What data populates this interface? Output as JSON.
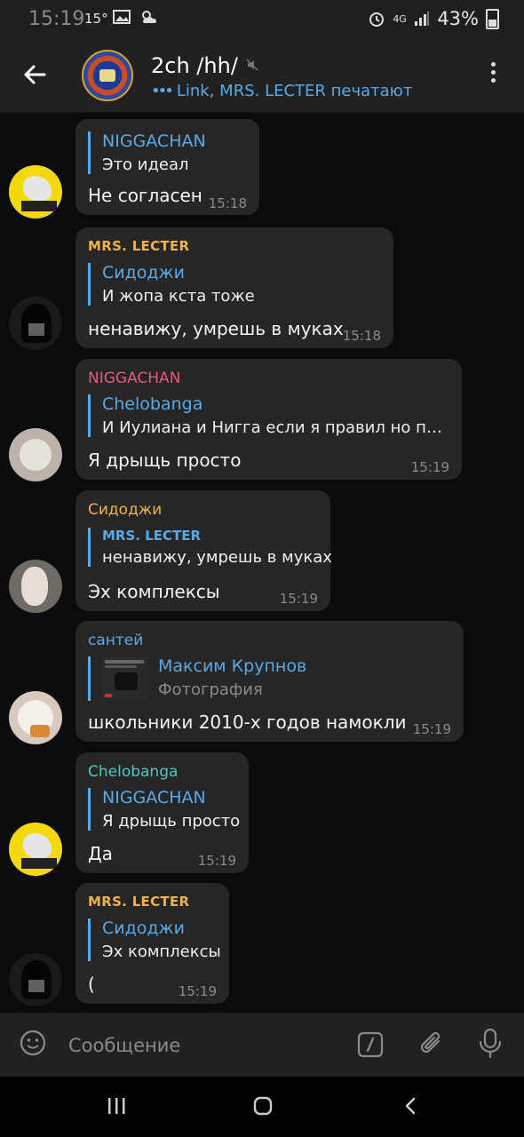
{
  "status_bar": {
    "time": "15:19",
    "temperature": "15°",
    "network": "4G",
    "battery": "43%"
  },
  "header": {
    "title": "2ch /hh/",
    "status_dots": "•••",
    "status": "Link, MRS. LECTER печатают"
  },
  "messages": [
    {
      "reply_name": "NIGGACHAN",
      "reply_text": "Это идеал",
      "text": "Не согласен",
      "time": "15:18",
      "avatar": "yellow-dog-avatar"
    },
    {
      "sender": "MRS. LECTER",
      "sender_color": "#f0b24e",
      "reply_name": "Сидоджи",
      "reply_text": "И жопа кста тоже",
      "text": "ненавижу, умрешь в муках",
      "time": "15:18",
      "avatar": "black-hood-avatar"
    },
    {
      "sender": "NIGGACHAN",
      "sender_color": "#e45b7b",
      "reply_name": "Chelobanga",
      "reply_text": "И Иулиана и Нигга если я правил но пом...",
      "text": "Я дрыщь просто",
      "time": "15:19",
      "avatar": "white-cat-avatar"
    },
    {
      "sender": "Сидоджи",
      "sender_color": "#f0b24e",
      "reply_name": "MRS. LECTER",
      "reply_text": "ненавижу, умрешь в муках",
      "text": "Эх комплексы",
      "time": "15:19",
      "avatar": "face-avatar"
    },
    {
      "sender": "сантей",
      "sender_color": "#5aa9e6",
      "reply_name": "Максим Крупнов",
      "reply_text": "Фотография",
      "text": "школьники 2010-х годов намокли",
      "time": "15:19",
      "avatar": "cat-bread-avatar"
    },
    {
      "sender": "Chelobanga",
      "sender_color": "#4fc7c0",
      "reply_name": "NIGGACHAN",
      "reply_text": "Я дрыщь просто",
      "text": "Да",
      "time": "15:19",
      "avatar": "yellow-dog-avatar"
    },
    {
      "sender": "MRS. LECTER",
      "sender_color": "#f0b24e",
      "reply_name": "Сидоджи",
      "reply_text": "Эх комплексы",
      "text": "(",
      "time": "15:19",
      "avatar": "black-hood-avatar"
    }
  ],
  "input": {
    "placeholder": "Сообщение"
  },
  "colors": {
    "accent": "#5aa9e6",
    "bubble": "#262626",
    "background": "#0b0b0b"
  }
}
